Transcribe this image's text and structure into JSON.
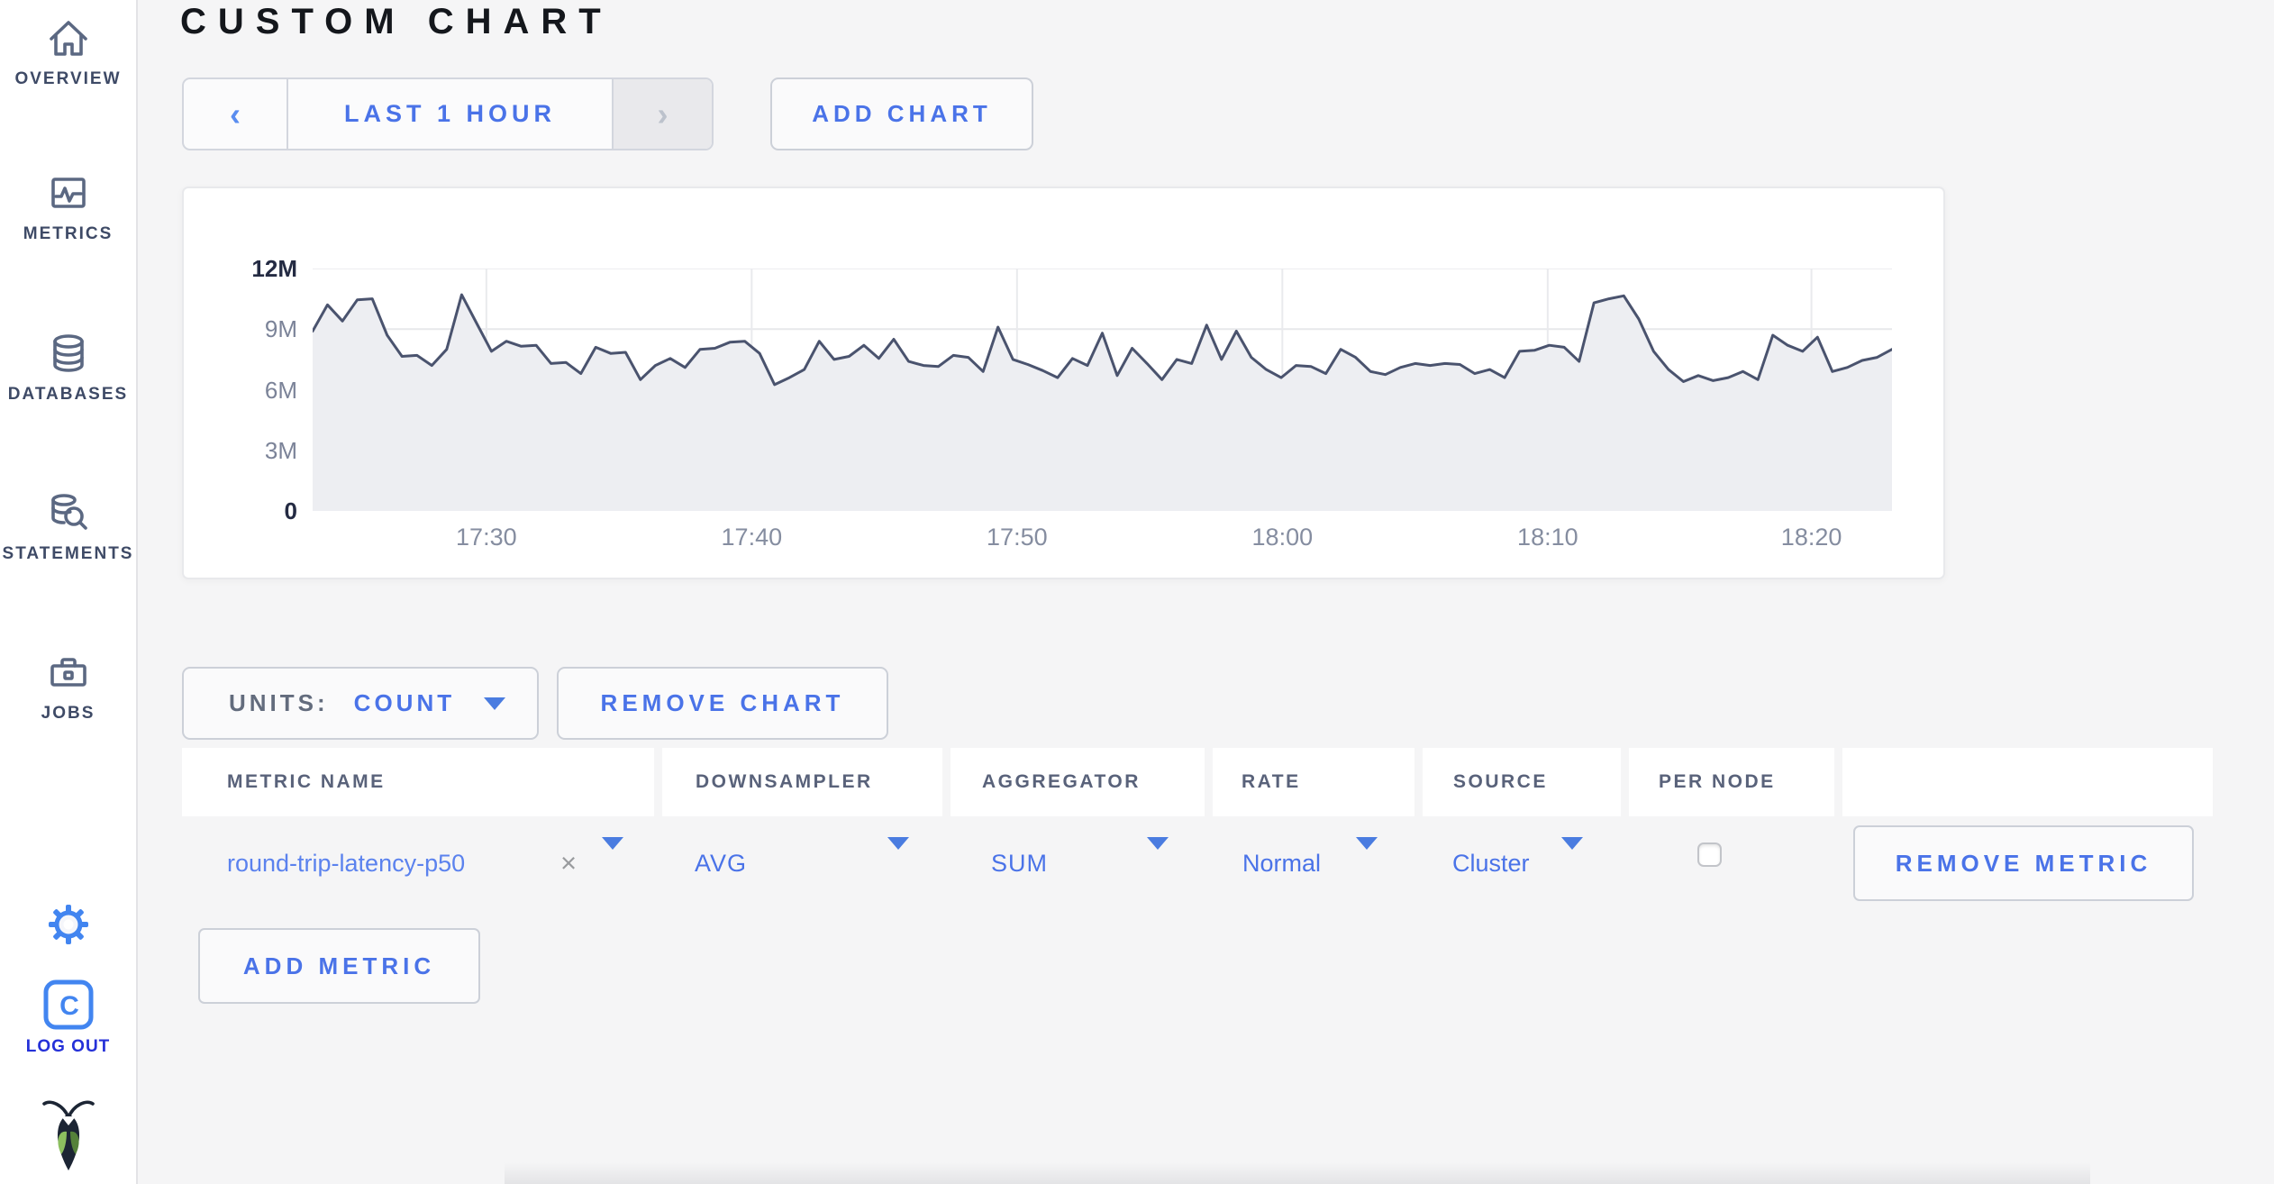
{
  "sidebar": {
    "items": [
      {
        "label": "OVERVIEW",
        "icon": "home-icon"
      },
      {
        "label": "METRICS",
        "icon": "metrics-icon"
      },
      {
        "label": "DATABASES",
        "icon": "database-icon"
      },
      {
        "label": "STATEMENTS",
        "icon": "statements-icon"
      },
      {
        "label": "JOBS",
        "icon": "briefcase-icon"
      }
    ],
    "logout": {
      "label": "LOG OUT",
      "initial": "C"
    }
  },
  "header": {
    "title": "CUSTOM CHART"
  },
  "toolbar": {
    "time_range_label": "LAST 1 HOUR",
    "prev_glyph": "‹",
    "next_glyph": "›",
    "add_chart_label": "ADD CHART"
  },
  "chart_controls": {
    "units_label": "UNITS:",
    "units_value": "COUNT",
    "remove_chart_label": "REMOVE CHART",
    "add_metric_label": "ADD METRIC"
  },
  "metric_table": {
    "columns": [
      "METRIC NAME",
      "DOWNSAMPLER",
      "AGGREGATOR",
      "RATE",
      "SOURCE",
      "PER NODE"
    ],
    "rows": [
      {
        "metric_name": "round-trip-latency-p50",
        "remove_glyph": "×",
        "downsampler": "AVG",
        "aggregator": "SUM",
        "rate": "Normal",
        "source": "Cluster",
        "per_node_checked": false,
        "remove_label": "REMOVE METRIC"
      }
    ]
  },
  "chart_data": {
    "type": "area",
    "title": "",
    "ylabel": "count",
    "ylim_millions": [
      0,
      12
    ],
    "grid": true,
    "y_ticks": [
      {
        "label": "12M",
        "value_millions": 12,
        "emphasis": true
      },
      {
        "label": "9M",
        "value_millions": 9,
        "emphasis": false
      },
      {
        "label": "6M",
        "value_millions": 6,
        "emphasis": false
      },
      {
        "label": "3M",
        "value_millions": 3,
        "emphasis": false
      },
      {
        "label": "0",
        "value_millions": 0,
        "emphasis": true
      }
    ],
    "x_ticks": [
      {
        "label": "17:30",
        "frac": 0.11
      },
      {
        "label": "17:40",
        "frac": 0.278
      },
      {
        "label": "17:50",
        "frac": 0.446
      },
      {
        "label": "18:00",
        "frac": 0.614
      },
      {
        "label": "18:10",
        "frac": 0.782
      },
      {
        "label": "18:20",
        "frac": 0.949
      }
    ],
    "series": [
      {
        "name": "round-trip-latency-p50",
        "values_millions": [
          8.9,
          10.2,
          9.4,
          10.45,
          10.5,
          8.7,
          7.65,
          7.7,
          7.2,
          8.0,
          10.7,
          9.3,
          7.9,
          8.4,
          8.15,
          8.2,
          7.3,
          7.35,
          6.8,
          8.1,
          7.8,
          7.85,
          6.5,
          7.2,
          7.55,
          7.1,
          8.0,
          8.05,
          8.35,
          8.4,
          7.8,
          6.25,
          6.6,
          7.0,
          8.4,
          7.5,
          7.65,
          8.2,
          7.55,
          8.5,
          7.4,
          7.2,
          7.15,
          7.7,
          7.6,
          6.9,
          9.1,
          7.5,
          7.25,
          6.95,
          6.6,
          7.55,
          7.2,
          8.8,
          6.7,
          8.05,
          7.3,
          6.5,
          7.5,
          7.3,
          9.2,
          7.5,
          8.9,
          7.6,
          7.0,
          6.6,
          7.2,
          7.15,
          6.8,
          8.0,
          7.6,
          6.9,
          6.75,
          7.1,
          7.3,
          7.2,
          7.3,
          7.25,
          6.8,
          7.0,
          6.6,
          7.9,
          7.95,
          8.2,
          8.1,
          7.4,
          10.3,
          10.5,
          10.65,
          9.5,
          7.9,
          7.0,
          6.4,
          6.7,
          6.45,
          6.6,
          6.9,
          6.5,
          8.7,
          8.2,
          7.9,
          8.6,
          6.9,
          7.1,
          7.45,
          7.6,
          8.0
        ]
      }
    ]
  },
  "colors": {
    "accent_blue": "#4a73e8",
    "bright_icon_blue": "#4285f0",
    "logout_blue": "#2430d8",
    "nav_text": "#3e4a66",
    "nav_icon_stroke": "#5b6882",
    "chart_line": "#4a536e",
    "chart_fill": "#edeef2",
    "gridline": "#e7e8eb",
    "page_bg": "#f5f5f6",
    "panel_bg": "#ffffff",
    "logo_body": "#1c2534",
    "logo_wing_light": "#8cbf5f",
    "logo_wing_dark": "#55813a"
  }
}
